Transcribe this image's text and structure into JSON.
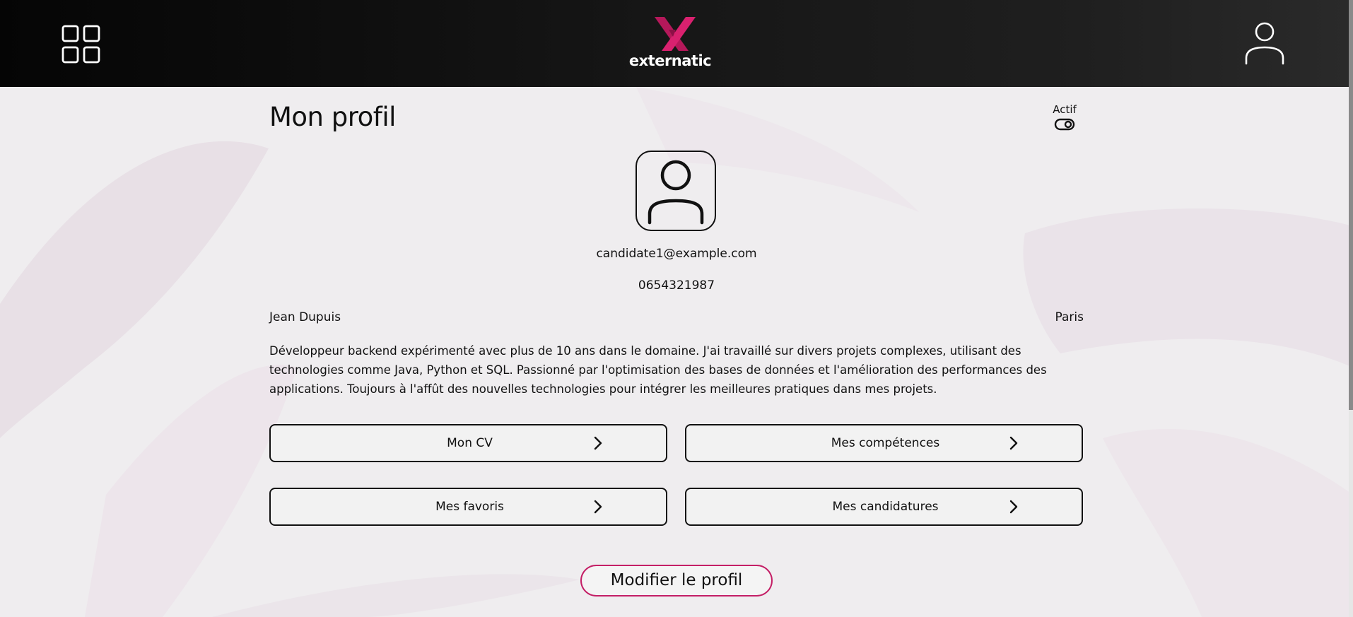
{
  "header": {
    "logo_text": "externatic",
    "menu_icon": "grid-icon",
    "user_icon": "user-icon"
  },
  "profile": {
    "title": "Mon profil",
    "status_label": "Actif",
    "status_toggle_icon": "toggle-icon",
    "avatar_icon": "user-avatar-icon",
    "email": "candidate1@example.com",
    "phone": "0654321987",
    "name": "Jean Dupuis",
    "city": "Paris",
    "bio": "Développeur backend expérimenté avec plus de 10 ans dans le domaine. J'ai travaillé sur divers projets complexes, utilisant des technologies comme Java, Python et SQL. Passionné par l'optimisation des bases de données et l'amélioration des performances des applications. Toujours à l'affût des nouvelles technologies pour intégrer les meilleures pratiques dans mes projets."
  },
  "cards": {
    "cv": "Mon CV",
    "skills": "Mes compétences",
    "favorites": "Mes favoris",
    "applications": "Mes candidatures",
    "chevron_icon": "chevron-right-icon"
  },
  "actions": {
    "edit_profile": "Modifier le profil"
  },
  "colors": {
    "accent": "#c41f66",
    "header_bg": "#0a0a0a",
    "page_bg": "#efedef"
  }
}
